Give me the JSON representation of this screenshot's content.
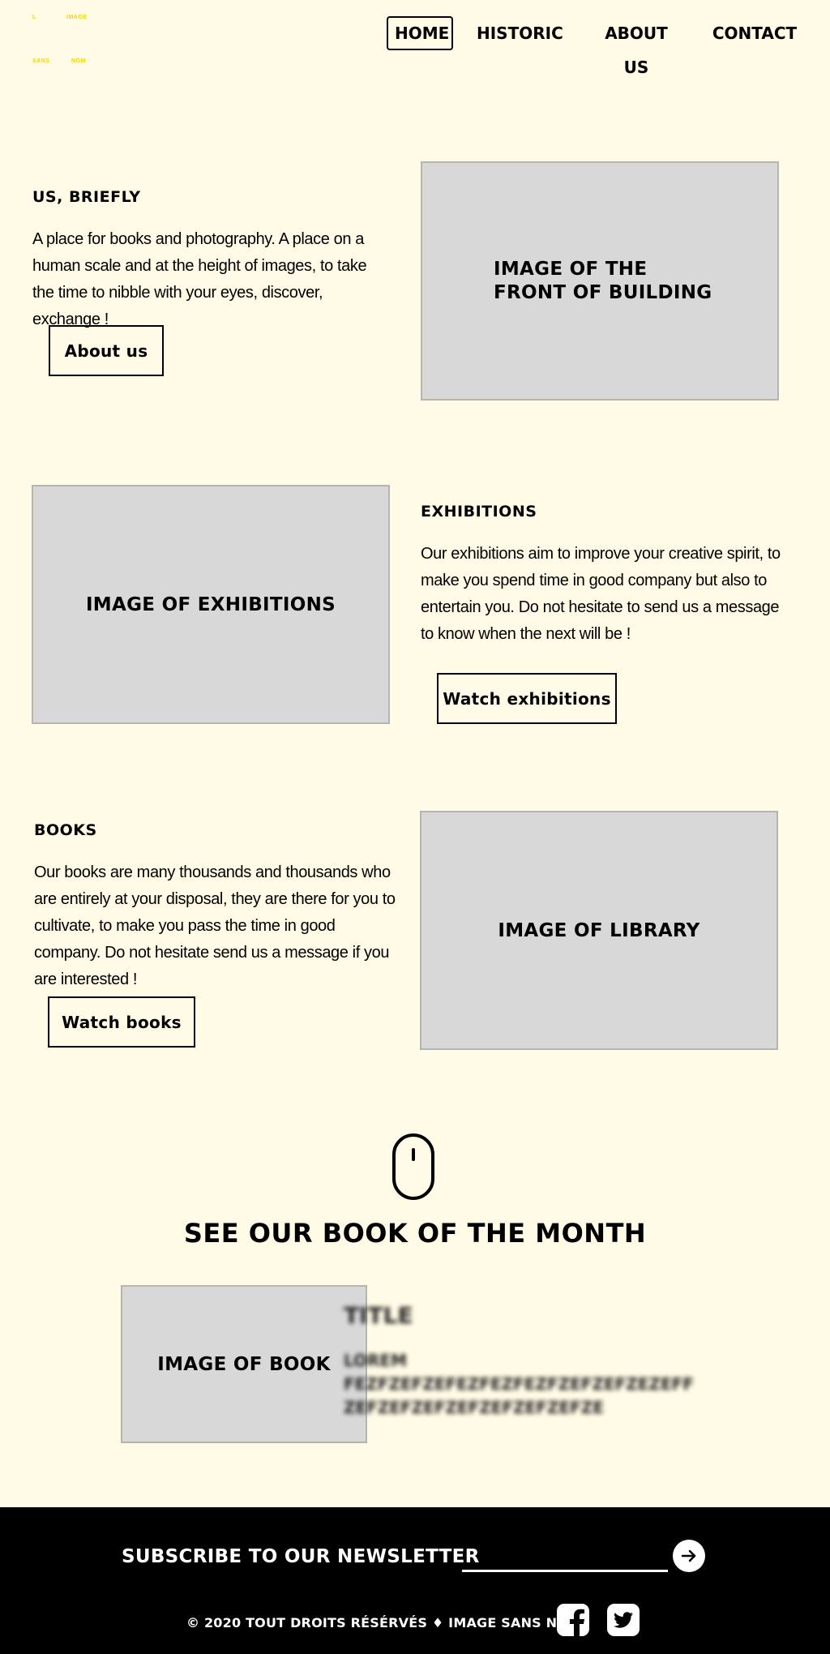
{
  "logo": {
    "line1_left": "L",
    "line1_right": "IMAGE",
    "line2_left": "SANS",
    "line2_right": "NOM"
  },
  "nav": {
    "items": [
      {
        "label": "HOME",
        "active": true
      },
      {
        "label": "HISTORIC",
        "active": false
      },
      {
        "label": "ABOUT US",
        "active": false
      },
      {
        "label": "CONTACT",
        "active": false
      }
    ]
  },
  "about": {
    "title": "US, BRIEFLY",
    "text": "A place for books and photography. A place on a human scale and at the height of images, to take the time to nibble with your eyes, discover, exchange !",
    "button": "About us",
    "image_label": "IMAGE OF THE FRONT OF BUILDING"
  },
  "exhibitions": {
    "title": "EXHIBITIONS",
    "text": "Our exhibitions aim to improve your creative spirit, to make you spend time in good company but also to entertain you. Do not hesitate to send us a message to know when the next will be !",
    "button": "Watch exhibitions",
    "image_label": "IMAGE OF EXHIBITIONS"
  },
  "books": {
    "title": "BOOKS",
    "text": "Our books are many thousands and thousands who are entirely at your disposal, they are there for you to cultivate, to make you pass the time in good company. Do not hesitate send us a message if you are interested !",
    "button": "Watch books",
    "image_label": "IMAGE OF LIBRARY"
  },
  "book_of_month": {
    "title": "SEE OUR BOOK OF THE MONTH",
    "image_label": "IMAGE OF BOOK",
    "book_title": "TITLE",
    "book_text_line1": "LOREM",
    "book_text_line2": "FEZFZEFZEFEZFEZFEZFZEFZEFZEZEFF",
    "book_text_line3": "ZEFZEFZEFZEFZEFZEFZEFZE"
  },
  "footer": {
    "newsletter_title": "SUBSCRIBE TO OUR NEWSLETTER",
    "newsletter_placeholder": "",
    "copyright": "© 2020 TOUT DROITS RÉSÉRVÉS ♦ IMAGE SANS NOM",
    "social": [
      "facebook-icon",
      "twitter-icon"
    ]
  },
  "colors": {
    "background": "#fffbe6",
    "logo_yellow": "#f2d500",
    "placeholder_gray": "#d8d8d8",
    "footer_bg": "#000000"
  }
}
